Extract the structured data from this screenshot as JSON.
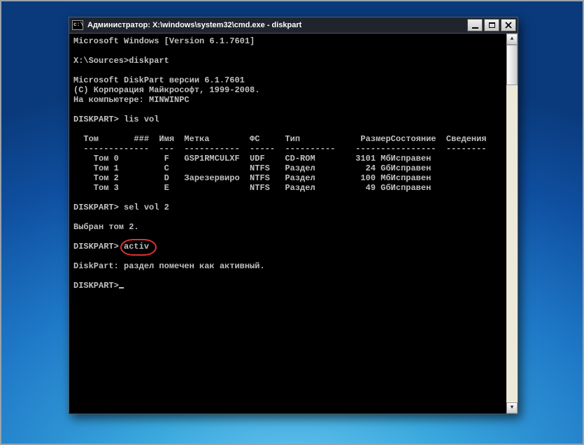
{
  "window": {
    "title": "Администратор: X:\\windows\\system32\\cmd.exe - diskpart",
    "icon_label": "c:\\"
  },
  "lines": {
    "l1": "Microsoft Windows [Version 6.1.7601]",
    "l2": "X:\\Sources>diskpart",
    "l3": "Microsoft DiskPart версии 6.1.7601",
    "l4": "(C) Корпорация Майкрософт, 1999-2008.",
    "l5": "На компьютере: MINWINPC",
    "l6": "DISKPART> lis vol",
    "l7": "DISKPART> sel vol 2",
    "l8": "Выбран том 2.",
    "l9_prompt": "DISKPART> ",
    "l9_cmd": "activ",
    "l10": "DiskPart: раздел помечен как активный.",
    "l11": "DISKPART>"
  },
  "table": {
    "headers": {
      "tom": "Том",
      "num": "###",
      "name": "Имя",
      "label": "Метка",
      "fs": "ФС",
      "type": "Тип",
      "size": "Размер",
      "status": "Состояние",
      "info": "Сведения"
    },
    "rows": [
      {
        "tom": "Том 0",
        "name": "F",
        "label": "GSP1RMCULXF",
        "fs": "UDF",
        "type": "CD-ROM",
        "size": "3101 Мб",
        "status": "Исправен"
      },
      {
        "tom": "Том 1",
        "name": "C",
        "label": "",
        "fs": "NTFS",
        "type": "Раздел",
        "size": "24 Gб",
        "status": "Исправен"
      },
      {
        "tom": "Том 2",
        "name": "D",
        "label": "Зарезервиро",
        "fs": "NTFS",
        "type": "Раздел",
        "size": "100 Мб",
        "status": "Исправен"
      },
      {
        "tom": "Том 3",
        "name": "E",
        "label": "",
        "fs": "NTFS",
        "type": "Раздел",
        "size": "49 Gб",
        "status": "Исправен"
      }
    ]
  },
  "highlight_command": "activ"
}
